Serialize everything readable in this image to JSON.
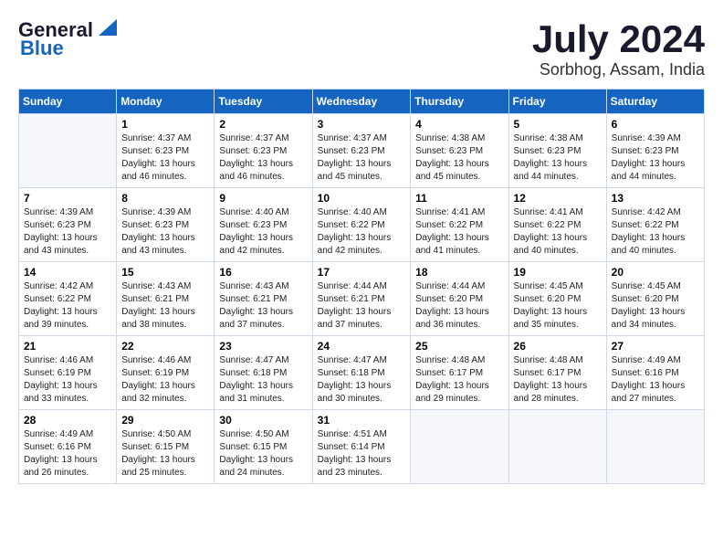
{
  "header": {
    "logo_line1": "General",
    "logo_line2": "Blue",
    "main_title": "July 2024",
    "subtitle": "Sorbhog, Assam, India"
  },
  "calendar": {
    "days_of_week": [
      "Sunday",
      "Monday",
      "Tuesday",
      "Wednesday",
      "Thursday",
      "Friday",
      "Saturday"
    ],
    "weeks": [
      [
        {
          "day": "",
          "info": ""
        },
        {
          "day": "1",
          "info": "Sunrise: 4:37 AM\nSunset: 6:23 PM\nDaylight: 13 hours\nand 46 minutes."
        },
        {
          "day": "2",
          "info": "Sunrise: 4:37 AM\nSunset: 6:23 PM\nDaylight: 13 hours\nand 46 minutes."
        },
        {
          "day": "3",
          "info": "Sunrise: 4:37 AM\nSunset: 6:23 PM\nDaylight: 13 hours\nand 45 minutes."
        },
        {
          "day": "4",
          "info": "Sunrise: 4:38 AM\nSunset: 6:23 PM\nDaylight: 13 hours\nand 45 minutes."
        },
        {
          "day": "5",
          "info": "Sunrise: 4:38 AM\nSunset: 6:23 PM\nDaylight: 13 hours\nand 44 minutes."
        },
        {
          "day": "6",
          "info": "Sunrise: 4:39 AM\nSunset: 6:23 PM\nDaylight: 13 hours\nand 44 minutes."
        }
      ],
      [
        {
          "day": "7",
          "info": "Sunrise: 4:39 AM\nSunset: 6:23 PM\nDaylight: 13 hours\nand 43 minutes."
        },
        {
          "day": "8",
          "info": "Sunrise: 4:39 AM\nSunset: 6:23 PM\nDaylight: 13 hours\nand 43 minutes."
        },
        {
          "day": "9",
          "info": "Sunrise: 4:40 AM\nSunset: 6:23 PM\nDaylight: 13 hours\nand 42 minutes."
        },
        {
          "day": "10",
          "info": "Sunrise: 4:40 AM\nSunset: 6:22 PM\nDaylight: 13 hours\nand 42 minutes."
        },
        {
          "day": "11",
          "info": "Sunrise: 4:41 AM\nSunset: 6:22 PM\nDaylight: 13 hours\nand 41 minutes."
        },
        {
          "day": "12",
          "info": "Sunrise: 4:41 AM\nSunset: 6:22 PM\nDaylight: 13 hours\nand 40 minutes."
        },
        {
          "day": "13",
          "info": "Sunrise: 4:42 AM\nSunset: 6:22 PM\nDaylight: 13 hours\nand 40 minutes."
        }
      ],
      [
        {
          "day": "14",
          "info": "Sunrise: 4:42 AM\nSunset: 6:22 PM\nDaylight: 13 hours\nand 39 minutes."
        },
        {
          "day": "15",
          "info": "Sunrise: 4:43 AM\nSunset: 6:21 PM\nDaylight: 13 hours\nand 38 minutes."
        },
        {
          "day": "16",
          "info": "Sunrise: 4:43 AM\nSunset: 6:21 PM\nDaylight: 13 hours\nand 37 minutes."
        },
        {
          "day": "17",
          "info": "Sunrise: 4:44 AM\nSunset: 6:21 PM\nDaylight: 13 hours\nand 37 minutes."
        },
        {
          "day": "18",
          "info": "Sunrise: 4:44 AM\nSunset: 6:20 PM\nDaylight: 13 hours\nand 36 minutes."
        },
        {
          "day": "19",
          "info": "Sunrise: 4:45 AM\nSunset: 6:20 PM\nDaylight: 13 hours\nand 35 minutes."
        },
        {
          "day": "20",
          "info": "Sunrise: 4:45 AM\nSunset: 6:20 PM\nDaylight: 13 hours\nand 34 minutes."
        }
      ],
      [
        {
          "day": "21",
          "info": "Sunrise: 4:46 AM\nSunset: 6:19 PM\nDaylight: 13 hours\nand 33 minutes."
        },
        {
          "day": "22",
          "info": "Sunrise: 4:46 AM\nSunset: 6:19 PM\nDaylight: 13 hours\nand 32 minutes."
        },
        {
          "day": "23",
          "info": "Sunrise: 4:47 AM\nSunset: 6:18 PM\nDaylight: 13 hours\nand 31 minutes."
        },
        {
          "day": "24",
          "info": "Sunrise: 4:47 AM\nSunset: 6:18 PM\nDaylight: 13 hours\nand 30 minutes."
        },
        {
          "day": "25",
          "info": "Sunrise: 4:48 AM\nSunset: 6:17 PM\nDaylight: 13 hours\nand 29 minutes."
        },
        {
          "day": "26",
          "info": "Sunrise: 4:48 AM\nSunset: 6:17 PM\nDaylight: 13 hours\nand 28 minutes."
        },
        {
          "day": "27",
          "info": "Sunrise: 4:49 AM\nSunset: 6:16 PM\nDaylight: 13 hours\nand 27 minutes."
        }
      ],
      [
        {
          "day": "28",
          "info": "Sunrise: 4:49 AM\nSunset: 6:16 PM\nDaylight: 13 hours\nand 26 minutes."
        },
        {
          "day": "29",
          "info": "Sunrise: 4:50 AM\nSunset: 6:15 PM\nDaylight: 13 hours\nand 25 minutes."
        },
        {
          "day": "30",
          "info": "Sunrise: 4:50 AM\nSunset: 6:15 PM\nDaylight: 13 hours\nand 24 minutes."
        },
        {
          "day": "31",
          "info": "Sunrise: 4:51 AM\nSunset: 6:14 PM\nDaylight: 13 hours\nand 23 minutes."
        },
        {
          "day": "",
          "info": ""
        },
        {
          "day": "",
          "info": ""
        },
        {
          "day": "",
          "info": ""
        }
      ]
    ]
  }
}
